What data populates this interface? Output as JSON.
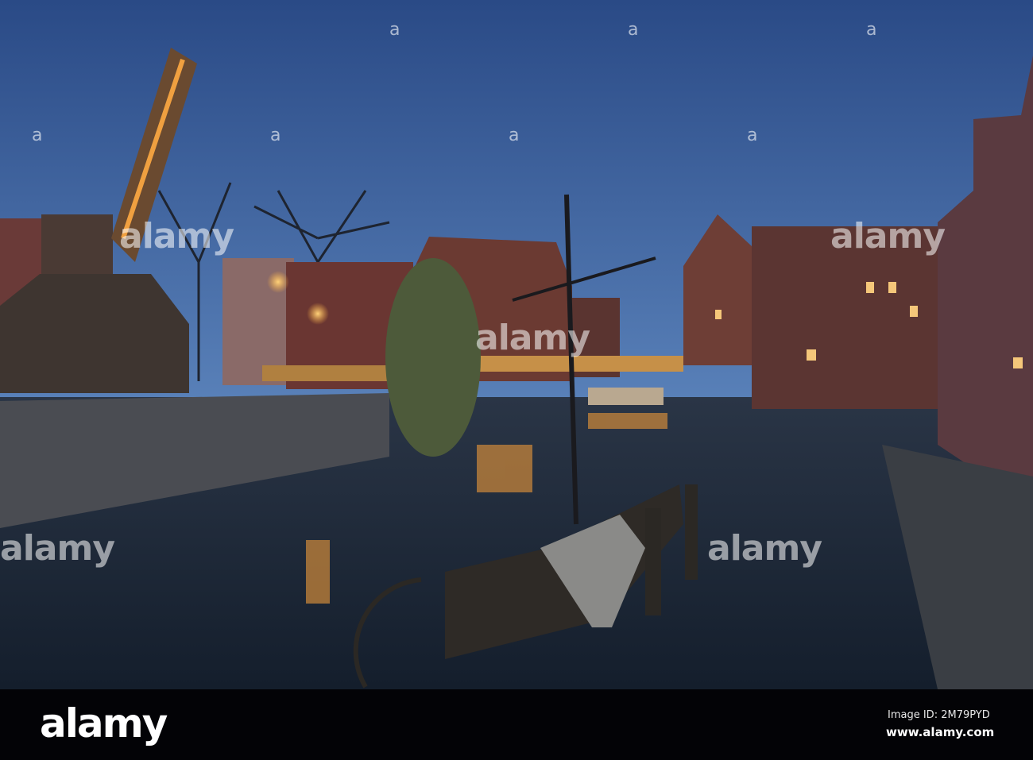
{
  "watermark": {
    "text": "alamy",
    "small_mark": "a"
  },
  "caption_bar": {
    "logo": "alamy",
    "image_id": "Image ID: 2M79PYD",
    "url": "www.alamy.com"
  },
  "colors": {
    "sky_top": "#2a4a86",
    "sky_bottom": "#4d78b4",
    "water": "#1a2738",
    "lights": "#f5b04a"
  }
}
